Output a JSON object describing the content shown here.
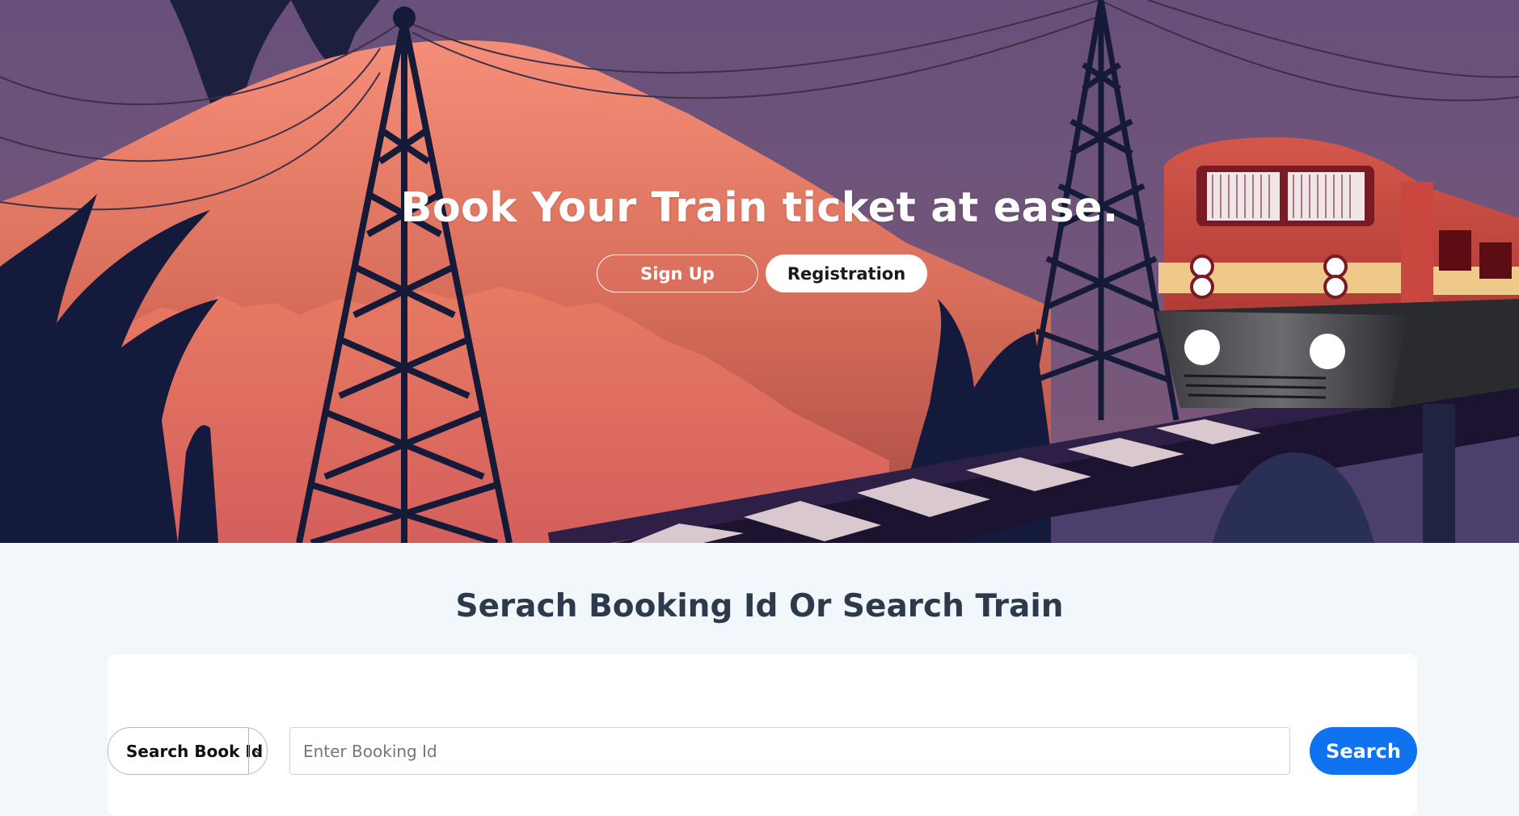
{
  "hero": {
    "title": "Book Your Train ticket at ease.",
    "signup_label": "Sign Up",
    "registration_label": "Registration"
  },
  "search": {
    "section_title": "Serach Booking Id Or Search Train",
    "mode_selected": "Search Book Id",
    "input_placeholder": "Enter Booking Id",
    "input_value": "",
    "search_label": "Search"
  },
  "colors": {
    "sky": "#6b4f78",
    "mountain": "#e77a63",
    "tower": "#131a3a",
    "primary_button": "#0f72ee",
    "page_background": "#f2f7fc"
  }
}
